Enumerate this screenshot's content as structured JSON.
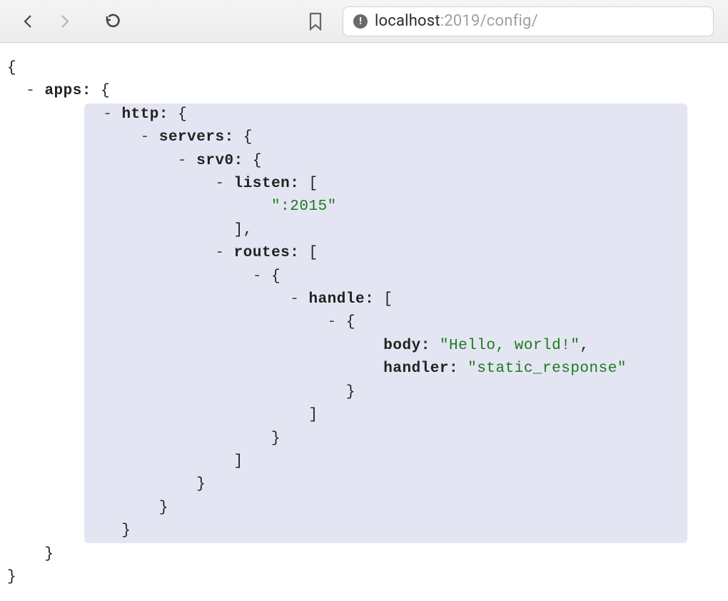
{
  "toolbar": {
    "back_name": "back",
    "forward_name": "forward",
    "reload_name": "reload",
    "bookmark_name": "bookmark"
  },
  "url": {
    "host": "localhost",
    "rest": ":2019/config/"
  },
  "json": {
    "keys": {
      "apps": "apps",
      "http": "http",
      "servers": "servers",
      "srv0": "srv0",
      "listen": "listen",
      "routes": "routes",
      "handle": "handle",
      "body": "body",
      "handler": "handler"
    },
    "values": {
      "listen0": "\":2015\"",
      "body": "\"Hello, world!\"",
      "handler": "\"static_response\""
    },
    "punct": {
      "open_brace": "{",
      "close_brace": "}",
      "open_bracket": "[",
      "close_bracket": "]",
      "close_bracket_comma": "],",
      "comma": ",",
      "colonsp": ": ",
      "dash": "-"
    }
  }
}
